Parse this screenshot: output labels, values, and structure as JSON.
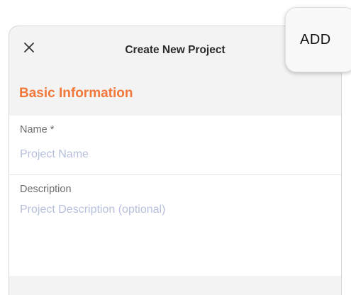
{
  "header": {
    "title": "Create New Project",
    "close_icon": "close-icon"
  },
  "section": {
    "title": "Basic Information",
    "accent_color": "#f2783a"
  },
  "fields": {
    "name": {
      "label": "Name *",
      "value": "",
      "placeholder": "Project Name"
    },
    "description": {
      "label": "Description",
      "value": "",
      "placeholder": "Project Description (optional)"
    }
  },
  "actions": {
    "add_label": "ADD"
  }
}
